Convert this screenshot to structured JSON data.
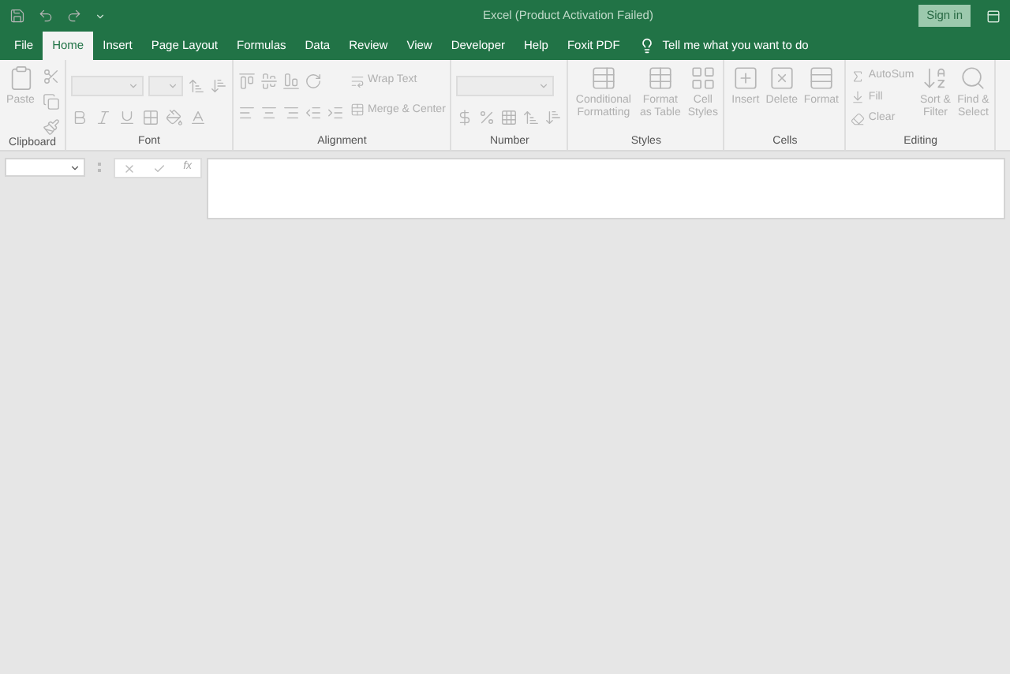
{
  "window": {
    "title": "Excel (Product Activation Failed)",
    "sign_in": "Sign in"
  },
  "tabs": [
    {
      "label": "File",
      "selected": false
    },
    {
      "label": "Home",
      "selected": true
    },
    {
      "label": "Insert",
      "selected": false
    },
    {
      "label": "Page Layout",
      "selected": false
    },
    {
      "label": "Formulas",
      "selected": false
    },
    {
      "label": "Data",
      "selected": false
    },
    {
      "label": "Review",
      "selected": false
    },
    {
      "label": "View",
      "selected": false
    },
    {
      "label": "Developer",
      "selected": false
    },
    {
      "label": "Help",
      "selected": false
    },
    {
      "label": "Foxit PDF",
      "selected": false
    }
  ],
  "tell_me": "Tell me what you want to do",
  "ribbon_groups": [
    {
      "kind": "clipboard",
      "label": "Clipboard",
      "buttons": [
        "Paste"
      ]
    },
    {
      "kind": "font",
      "label": "Font"
    },
    {
      "kind": "alignment",
      "label": "Alignment",
      "buttons": [
        "Wrap Text",
        "Merge & Center"
      ]
    },
    {
      "kind": "number",
      "label": "Number"
    },
    {
      "kind": "styles",
      "label": "Styles",
      "buttons": [
        "Conditional Formatting",
        "Format as Table",
        "Cell Styles"
      ]
    },
    {
      "kind": "cells",
      "label": "Cells",
      "buttons": [
        "Insert",
        "Delete",
        "Format"
      ]
    },
    {
      "kind": "editing",
      "label": "Editing",
      "buttons": [
        "AutoSum",
        "Fill",
        "Clear",
        "Sort & Filter",
        "Find & Select"
      ]
    }
  ],
  "formula_bar": {
    "fx": "fx"
  }
}
